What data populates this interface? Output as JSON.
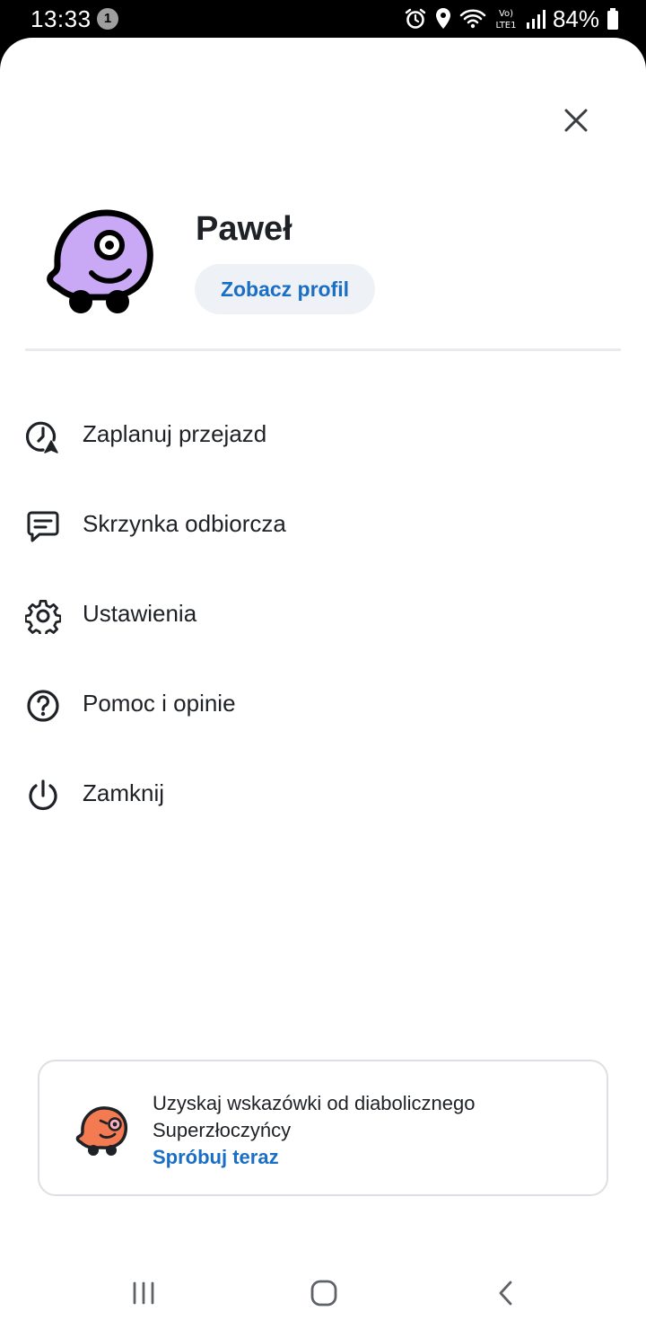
{
  "status_bar": {
    "time": "13:33",
    "notification_count": "1",
    "battery": "84%",
    "icons": [
      "alarm-icon",
      "location-icon",
      "wifi-icon",
      "volte-icon",
      "signal-icon",
      "battery-icon"
    ]
  },
  "profile": {
    "name": "Paweł",
    "view_profile_label": "Zobacz profil"
  },
  "menu": {
    "items": [
      {
        "label": "Zaplanuj przejazd",
        "icon": "plan-drive-clock-icon"
      },
      {
        "label": "Skrzynka odbiorcza",
        "icon": "inbox-message-icon"
      },
      {
        "label": "Ustawienia",
        "icon": "settings-gear-icon"
      },
      {
        "label": "Pomoc i opinie",
        "icon": "help-question-icon"
      },
      {
        "label": "Zamknij",
        "icon": "power-icon"
      }
    ]
  },
  "promo": {
    "text": "Uzyskaj wskazówki od diabolicznego Superzłoczyńcy",
    "link": "Spróbuj teraz",
    "icon": "villain-waze-icon"
  },
  "colors": {
    "accent": "#1a6fc4",
    "avatar_fill": "#c9a8f5",
    "promo_icon_fill": "#f47a52",
    "text": "#1e2125"
  }
}
